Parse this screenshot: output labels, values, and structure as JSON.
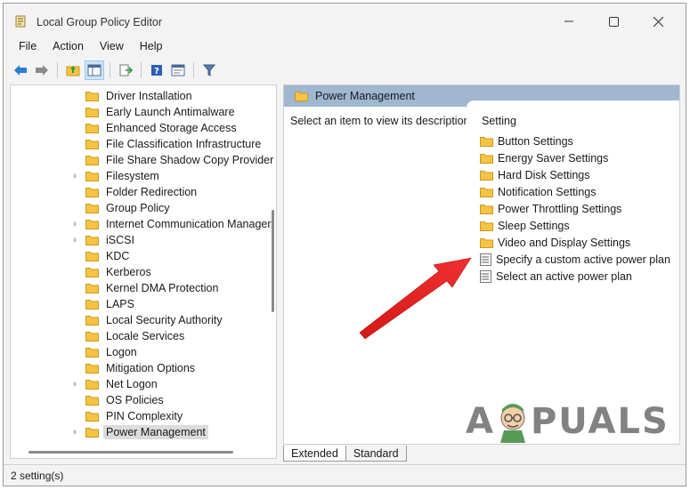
{
  "window": {
    "title": "Local Group Policy Editor"
  },
  "menubar": [
    "File",
    "Action",
    "View",
    "Help"
  ],
  "toolbar": {
    "icons": [
      "back-icon",
      "forward-icon",
      "up-folder-icon",
      "show-hide-tree-icon",
      "export-list-icon",
      "help-icon",
      "properties-icon",
      "filter-icon"
    ]
  },
  "tree": {
    "items": [
      {
        "label": "Driver Installation",
        "expandable": false
      },
      {
        "label": "Early Launch Antimalware",
        "expandable": false
      },
      {
        "label": "Enhanced Storage Access",
        "expandable": false
      },
      {
        "label": "File Classification Infrastructure",
        "expandable": false
      },
      {
        "label": "File Share Shadow Copy Provider",
        "expandable": false
      },
      {
        "label": "Filesystem",
        "expandable": true
      },
      {
        "label": "Folder Redirection",
        "expandable": false
      },
      {
        "label": "Group Policy",
        "expandable": false
      },
      {
        "label": "Internet Communication Manager",
        "expandable": true
      },
      {
        "label": "iSCSI",
        "expandable": true
      },
      {
        "label": "KDC",
        "expandable": false
      },
      {
        "label": "Kerberos",
        "expandable": false
      },
      {
        "label": "Kernel DMA Protection",
        "expandable": false
      },
      {
        "label": "LAPS",
        "expandable": false
      },
      {
        "label": "Local Security Authority",
        "expandable": false
      },
      {
        "label": "Locale Services",
        "expandable": false
      },
      {
        "label": "Logon",
        "expandable": false
      },
      {
        "label": "Mitigation Options",
        "expandable": false
      },
      {
        "label": "Net Logon",
        "expandable": true
      },
      {
        "label": "OS Policies",
        "expandable": false
      },
      {
        "label": "PIN Complexity",
        "expandable": false
      },
      {
        "label": "Power Management",
        "expandable": true,
        "selected": true
      }
    ]
  },
  "right_pane": {
    "header": "Power Management",
    "description": "Select an item to view its description.",
    "column_header": "Setting",
    "items": [
      {
        "label": "Button Settings",
        "type": "folder"
      },
      {
        "label": "Energy Saver Settings",
        "type": "folder"
      },
      {
        "label": "Hard Disk Settings",
        "type": "folder"
      },
      {
        "label": "Notification Settings",
        "type": "folder"
      },
      {
        "label": "Power Throttling Settings",
        "type": "folder"
      },
      {
        "label": "Sleep Settings",
        "type": "folder"
      },
      {
        "label": "Video and Display Settings",
        "type": "folder"
      },
      {
        "label": "Specify a custom active power plan",
        "type": "setting"
      },
      {
        "label": "Select an active power plan",
        "type": "setting"
      }
    ]
  },
  "tabs": [
    "Extended",
    "Standard"
  ],
  "status": "2 setting(s)",
  "watermark": {
    "left": "A",
    "right": "PUALS"
  },
  "colors": {
    "header_bg": "#9fb7d0",
    "folder": "#f5c542",
    "arrow": "#e02020"
  }
}
